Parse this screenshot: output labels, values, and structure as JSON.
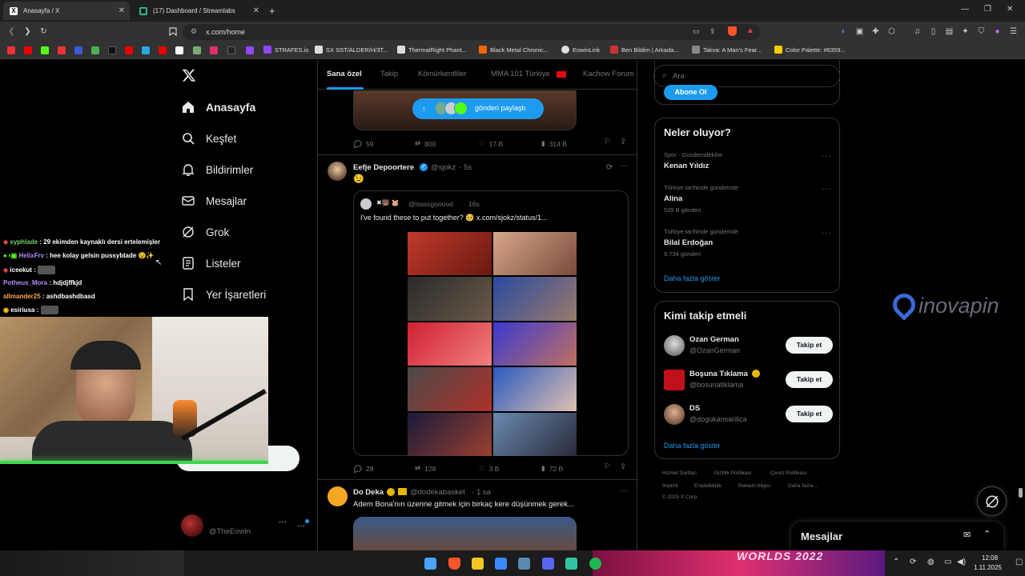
{
  "browser": {
    "tabs": [
      {
        "title": "Anasayfa / X",
        "icon": "x-logo-icon",
        "active": true
      },
      {
        "title": "(17) Dashboard / Streamlabs",
        "icon": "streamlabs-icon",
        "active": false
      }
    ],
    "url": "x.com/home",
    "bookmarks": [
      "STRAFES.io",
      "SX SST/ALDER/H/3T...",
      "ThermalRight Phant...",
      "Black Metal Chronic...",
      "EowinLink",
      "Ben Bildim | Arkada...",
      "Takva: A Man's Fear...",
      "Color Palette: #6359..."
    ]
  },
  "sidebar": {
    "logo": "x-logo-icon",
    "items": [
      {
        "label": "Anasayfa",
        "icon": "home-icon"
      },
      {
        "label": "Keşfet",
        "icon": "search-icon"
      },
      {
        "label": "Bildirimler",
        "icon": "bell-icon"
      },
      {
        "label": "Mesajlar",
        "icon": "mail-icon"
      },
      {
        "label": "Grok",
        "icon": "grok-icon"
      },
      {
        "label": "Listeler",
        "icon": "list-icon"
      },
      {
        "label": "Yer İşaretleri",
        "icon": "bookmark-icon"
      }
    ],
    "account_handle": "@TheEowin"
  },
  "feed": {
    "tabs": [
      "Sana özel",
      "Takip",
      "Kömürkentliler",
      "MMA 101 Türkiye",
      "Kachow Forum"
    ],
    "share_pill": "gönderi paylaştı",
    "post1_actions": {
      "replies": "59",
      "reposts": "800",
      "likes": "17 B",
      "views": "314 B"
    },
    "post2": {
      "name": "Eefje Depoortere",
      "handle": "@sjokz",
      "time": "5s",
      "emoji": "😉",
      "quote_handle": "@lssssgooood",
      "quote_time": "16s",
      "quote_text": "I've found these to put together? 🥺 x.com/sjokz/status/1...",
      "actions": {
        "replies": "28",
        "reposts": "128",
        "likes": "3 B",
        "views": "72 B"
      }
    },
    "post3": {
      "name": "Do Deka",
      "handle": "@dodekabasket",
      "time": "1 sa",
      "text": "Adem Bona'nın üzerine gitmek için birkaç kere düşünmek gerek..."
    }
  },
  "right": {
    "search_placeholder": "Ara",
    "subscribe_btn": "Abone Ol",
    "trends_title": "Neler oluyor?",
    "trends": [
      {
        "meta": "Spor · Gündemdekiler",
        "name": "Kenan Yıldız",
        "count": ""
      },
      {
        "meta": "Türkiye tarihinde gündemde",
        "name": "Alina",
        "count": "539 B gönderi"
      },
      {
        "meta": "Türkiye tarihinde gündemde",
        "name": "Bilal Erdoğan",
        "count": "9.734 gönderi"
      }
    ],
    "trends_more": "Daha fazla göster",
    "who_title": "Kimi takip etmeli",
    "who": [
      {
        "name": "Ozan German",
        "handle": "@OzanGerman"
      },
      {
        "name": "Boşuna Tıklama",
        "handle": "@bosunatiklama"
      },
      {
        "name": "DS",
        "handle": "@dogukansarilica"
      }
    ],
    "follow_label": "Takip et",
    "who_more": "Daha fazla göster",
    "footer": [
      "Hizmet Şartları",
      "Gizlilik Politikası",
      "Çerez Politikası",
      "Imprint",
      "Erişilebilirlik",
      "Reklam bilgisi",
      "Daha fazla ...",
      "© 2025 X Corp."
    ],
    "messages_label": "Mesajlar"
  },
  "overlay": {
    "chat": [
      {
        "user": "syphlade",
        "msg": ": 29 ekimden kaynaklı dersi ertelemişler",
        "color": "#6fd36f"
      },
      {
        "user": "HelixFrv",
        "msg": ": hee kolay gelsin pussyblade",
        "color": "#b58cff"
      },
      {
        "user": "iceekut",
        "msg": ":",
        "color": "#ffffff"
      },
      {
        "user": "Potheus_Mora",
        "msg": ": hdjdjffkjd",
        "color": "#b58cff"
      },
      {
        "user": "allmander25",
        "msg": ": ashdbashdbasd",
        "color": "#ffa94d"
      },
      {
        "user": "esiriusa",
        "msg": ":",
        "color": "#ffffff"
      }
    ],
    "watermark": "inovapin"
  },
  "taskbar": {
    "time": "12:08",
    "date": "1.11.2025",
    "banner_text": "WORLDS 2022"
  }
}
